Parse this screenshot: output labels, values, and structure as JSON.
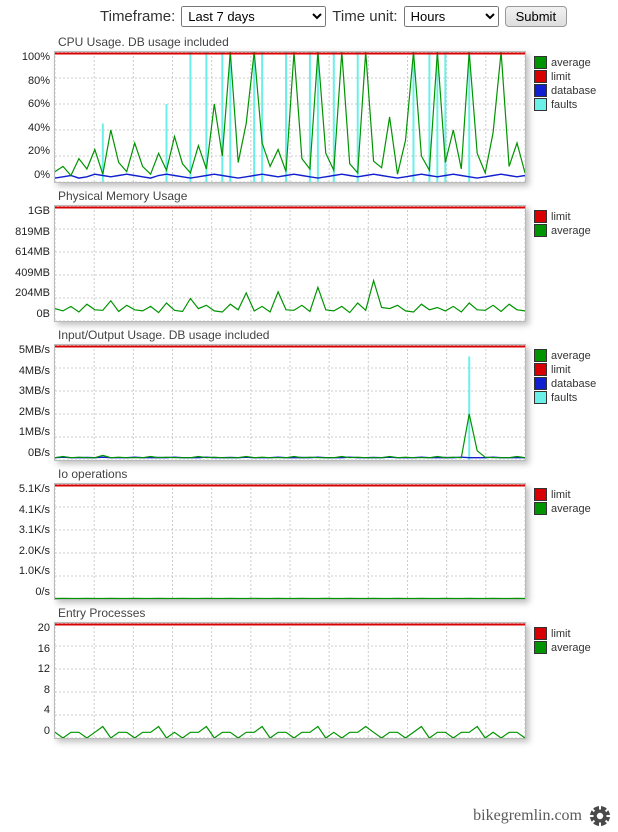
{
  "controls": {
    "timeframe_label": "Timeframe:",
    "timeframe_value": "Last 7 days",
    "timeunit_label": "Time unit:",
    "timeunit_value": "Hours",
    "submit_label": "Submit"
  },
  "legend_labels": {
    "average": "average",
    "limit": "limit",
    "database": "database",
    "faults": "faults"
  },
  "colors": {
    "average": "#009400",
    "limit": "#d80000",
    "database": "#1020d0",
    "faults": "#6af0e8"
  },
  "footer": {
    "text": "bikegremlin.com"
  },
  "chart_data": [
    {
      "id": "cpu",
      "type": "line",
      "title": "CPU Usage. DB usage included",
      "ylabel": "",
      "ylim": [
        0,
        100
      ],
      "yticks": [
        "100%",
        "80%",
        "60%",
        "40%",
        "20%",
        "0%"
      ],
      "height": 130,
      "legend": [
        "average",
        "limit",
        "database",
        "faults"
      ],
      "series": {
        "limit": {
          "value": 100,
          "color": "limit"
        },
        "database": {
          "color": "database",
          "values": [
            3,
            4,
            5,
            3,
            4,
            6,
            5,
            4,
            5,
            6,
            5,
            4,
            3,
            5,
            6,
            5,
            4,
            3,
            4,
            5,
            6,
            5,
            4,
            3,
            4,
            5,
            6,
            5,
            4,
            5,
            6,
            5,
            4,
            3,
            4,
            5,
            6,
            5,
            4,
            5,
            6,
            5,
            4,
            3,
            4,
            5,
            6,
            5,
            4,
            5,
            6,
            5,
            4,
            3,
            4,
            5,
            6,
            5,
            4,
            5
          ]
        },
        "average": {
          "color": "average",
          "values": [
            8,
            12,
            5,
            18,
            10,
            25,
            6,
            40,
            15,
            8,
            30,
            12,
            6,
            22,
            9,
            35,
            14,
            7,
            28,
            10,
            60,
            20,
            100,
            15,
            45,
            100,
            30,
            12,
            25,
            8,
            100,
            18,
            10,
            100,
            22,
            9,
            100,
            14,
            7,
            100,
            16,
            11,
            50,
            6,
            32,
            100,
            20,
            9,
            100,
            15,
            40,
            10,
            100,
            22,
            7,
            38,
            100,
            12,
            30,
            7
          ]
        },
        "faults": {
          "color": "faults",
          "values": [
            0,
            0,
            0,
            0,
            0,
            0,
            45,
            0,
            0,
            0,
            0,
            0,
            0,
            0,
            60,
            0,
            0,
            100,
            0,
            100,
            0,
            100,
            100,
            0,
            0,
            100,
            100,
            0,
            0,
            100,
            0,
            0,
            100,
            100,
            0,
            100,
            0,
            0,
            100,
            0,
            0,
            0,
            0,
            0,
            0,
            100,
            0,
            100,
            100,
            100,
            0,
            0,
            100,
            0,
            0,
            0,
            0,
            0,
            0,
            0
          ]
        }
      }
    },
    {
      "id": "mem",
      "type": "line",
      "title": "Physical Memory Usage",
      "ylabel": "",
      "ylim": [
        0,
        1024
      ],
      "yticks": [
        "1GB",
        "819MB",
        "614MB",
        "409MB",
        "204MB",
        "0B"
      ],
      "height": 115,
      "legend": [
        "limit",
        "average"
      ],
      "series": {
        "limit": {
          "value": 1024,
          "color": "limit"
        },
        "average": {
          "color": "average",
          "values": [
            110,
            90,
            130,
            80,
            150,
            100,
            95,
            180,
            85,
            140,
            100,
            90,
            130,
            75,
            160,
            95,
            85,
            200,
            110,
            140,
            90,
            80,
            150,
            100,
            250,
            90,
            130,
            80,
            260,
            100,
            95,
            140,
            85,
            300,
            100,
            90,
            130,
            75,
            160,
            95,
            360,
            120,
            110,
            140,
            90,
            80,
            150,
            100,
            120,
            90,
            130,
            80,
            160,
            100,
            95,
            140,
            85,
            150,
            100,
            90
          ]
        }
      }
    },
    {
      "id": "io",
      "type": "line",
      "title": "Input/Output Usage. DB usage included",
      "ylabel": "",
      "ylim": [
        0,
        5
      ],
      "yticks": [
        "5MB/s",
        "4MB/s",
        "3MB/s",
        "2MB/s",
        "1MB/s",
        "0B/s"
      ],
      "height": 115,
      "legend": [
        "average",
        "limit",
        "database",
        "faults"
      ],
      "series": {
        "limit": {
          "value": 5,
          "color": "limit"
        },
        "database": {
          "color": "database",
          "values": [
            0.1,
            0.12,
            0.1,
            0.1,
            0.11,
            0.1,
            0.12,
            0.1,
            0.1,
            0.1,
            0.12,
            0.1,
            0.1,
            0.11,
            0.1,
            0.12,
            0.1,
            0.1,
            0.1,
            0.12,
            0.1,
            0.1,
            0.11,
            0.1,
            0.12,
            0.1,
            0.1,
            0.1,
            0.12,
            0.1,
            0.1,
            0.11,
            0.1,
            0.12,
            0.1,
            0.1,
            0.1,
            0.12,
            0.1,
            0.1,
            0.11,
            0.1,
            0.12,
            0.1,
            0.1,
            0.1,
            0.12,
            0.1,
            0.1,
            0.11,
            0.1,
            0.12,
            0.1,
            0.1,
            0.1,
            0.12,
            0.1,
            0.1,
            0.11,
            0.1
          ]
        },
        "average": {
          "color": "average",
          "values": [
            0.1,
            0.15,
            0.1,
            0.12,
            0.1,
            0.1,
            0.2,
            0.1,
            0.12,
            0.1,
            0.1,
            0.1,
            0.15,
            0.1,
            0.12,
            0.1,
            0.1,
            0.1,
            0.15,
            0.1,
            0.12,
            0.1,
            0.1,
            0.1,
            0.15,
            0.1,
            0.12,
            0.1,
            0.1,
            0.1,
            0.15,
            0.1,
            0.12,
            0.1,
            0.1,
            0.1,
            0.15,
            0.1,
            0.12,
            0.1,
            0.1,
            0.1,
            0.15,
            0.1,
            0.12,
            0.1,
            0.1,
            0.1,
            0.15,
            0.1,
            0.12,
            0.1,
            2.0,
            0.4,
            0.12,
            0.1,
            0.1,
            0.1,
            0.15,
            0.1
          ]
        },
        "faults": {
          "color": "faults",
          "values": [
            0,
            0,
            0,
            0,
            0,
            0,
            0,
            0,
            0,
            0,
            0,
            0,
            0,
            0,
            0,
            0,
            0,
            0,
            0,
            0,
            0,
            0,
            0,
            0,
            0,
            0,
            0,
            0,
            0,
            0,
            0,
            0,
            0,
            0,
            0,
            0,
            0,
            0,
            0,
            0,
            0,
            0,
            0,
            0,
            0,
            0,
            0,
            0,
            0,
            0,
            0,
            0,
            4.5,
            0,
            0,
            0,
            0,
            0,
            0,
            0
          ]
        }
      }
    },
    {
      "id": "iops",
      "type": "line",
      "title": "Io operations",
      "ylabel": "",
      "ylim": [
        0,
        5.1
      ],
      "yticks": [
        "5.1K/s",
        "4.1K/s",
        "3.1K/s",
        "2.0K/s",
        "1.0K/s",
        "0/s"
      ],
      "height": 115,
      "legend": [
        "limit",
        "average"
      ],
      "series": {
        "limit": {
          "value": 5.1,
          "color": "limit"
        },
        "average": {
          "color": "average",
          "values": [
            0.02,
            0.03,
            0.02,
            0.02,
            0.03,
            0.02,
            0.02,
            0.03,
            0.02,
            0.02,
            0.03,
            0.02,
            0.02,
            0.03,
            0.02,
            0.02,
            0.03,
            0.02,
            0.02,
            0.03,
            0.02,
            0.02,
            0.03,
            0.02,
            0.02,
            0.03,
            0.02,
            0.02,
            0.03,
            0.02,
            0.02,
            0.03,
            0.02,
            0.02,
            0.03,
            0.02,
            0.02,
            0.03,
            0.02,
            0.02,
            0.03,
            0.02,
            0.02,
            0.03,
            0.02,
            0.02,
            0.03,
            0.02,
            0.02,
            0.03,
            0.02,
            0.02,
            0.03,
            0.02,
            0.02,
            0.03,
            0.02,
            0.02,
            0.03,
            0.02
          ]
        }
      }
    },
    {
      "id": "ep",
      "type": "line",
      "title": "Entry Processes",
      "ylabel": "",
      "ylim": [
        0,
        20
      ],
      "yticks": [
        "20",
        "16",
        "12",
        "8",
        "4",
        "0"
      ],
      "height": 115,
      "legend": [
        "limit",
        "average"
      ],
      "series": {
        "limit": {
          "value": 20,
          "color": "limit"
        },
        "average": {
          "color": "average",
          "values": [
            1,
            0,
            1,
            1,
            0,
            1,
            2,
            0,
            1,
            1,
            0,
            1,
            1,
            2,
            0,
            1,
            0,
            1,
            1,
            2,
            0,
            1,
            1,
            0,
            1,
            1,
            2,
            0,
            1,
            1,
            0,
            1,
            1,
            2,
            0,
            1,
            0,
            1,
            1,
            2,
            1,
            0,
            1,
            1,
            0,
            1,
            2,
            0,
            1,
            1,
            0,
            1,
            1,
            2,
            0,
            1,
            0,
            1,
            1,
            0
          ]
        }
      }
    }
  ]
}
